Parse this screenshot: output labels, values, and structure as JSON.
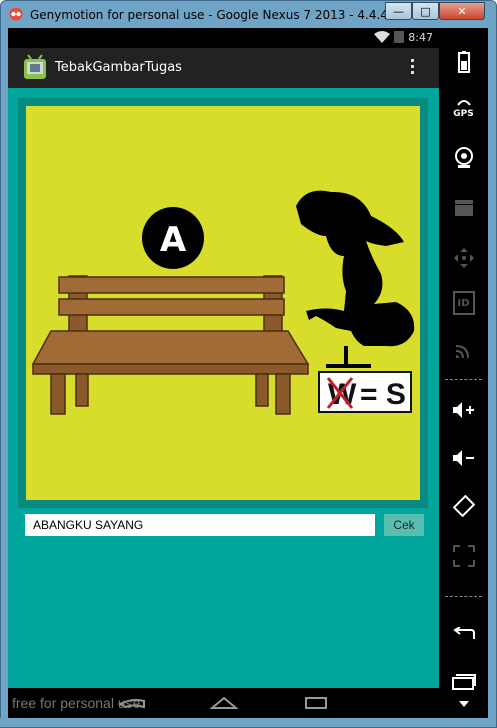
{
  "window": {
    "title": "Genymotion for personal use - Google Nexus 7 2013 - 4.4.4 - API...",
    "min_label": "—",
    "max_label": "□",
    "close_label": "✕"
  },
  "status_bar": {
    "time": "8:47"
  },
  "action_bar": {
    "app_title": "TebakGambarTugas"
  },
  "puzzle": {
    "letter": "A",
    "equation_left": "W",
    "equation_right": "= S"
  },
  "answer": {
    "value": "ABANGKU SAYANG",
    "button_label": "Cek"
  },
  "watermark": "free for personal use",
  "side_panel": {
    "items": [
      "battery-icon",
      "gps-icon",
      "webcam-icon",
      "media-icon",
      "dpad-icon",
      "id-icon",
      "cast-icon",
      "volume-up-icon",
      "volume-down-icon",
      "rotate-icon",
      "scale-icon",
      "back-icon",
      "recents-icon",
      "menu-down-icon"
    ],
    "gps_label": "GPS",
    "id_label": "ID"
  },
  "colors": {
    "screen_bg": "#00a69c",
    "puzzle_bg": "#d8dc2b",
    "action_bar": "#222222"
  }
}
